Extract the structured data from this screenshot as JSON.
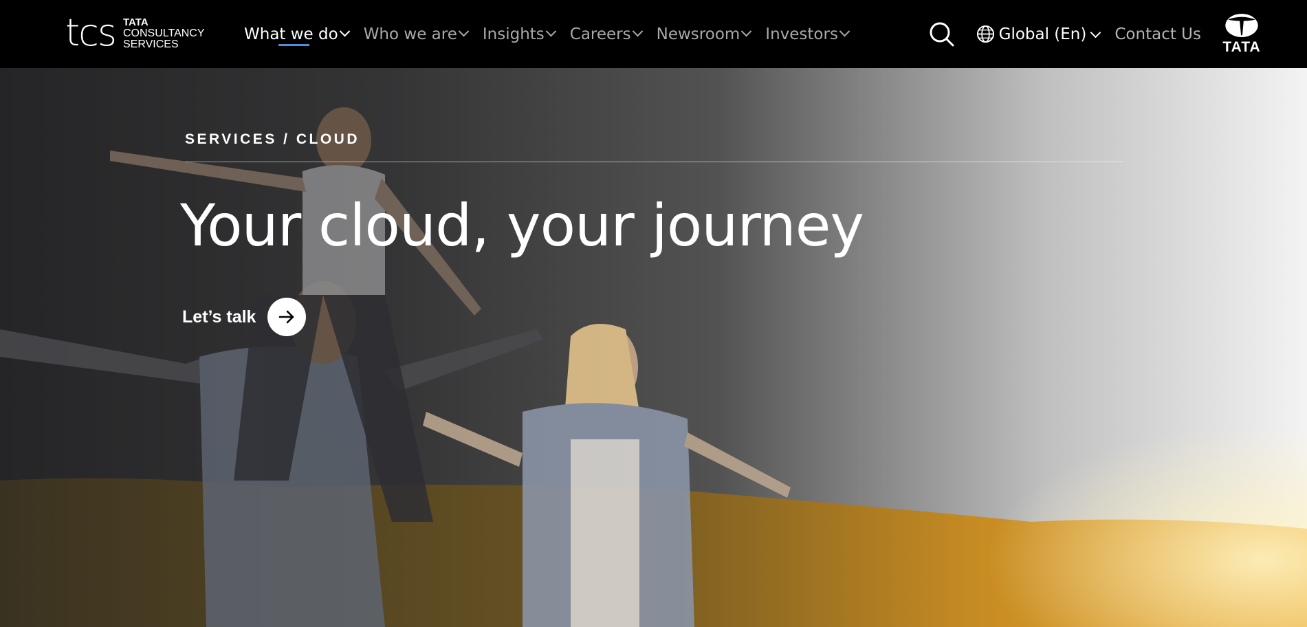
{
  "brand": {
    "logo_mark": "tcs",
    "logo_line1": "TATA",
    "logo_line2": "CONSULTANCY",
    "logo_line3": "SERVICES",
    "parent_logo_text": "TATA"
  },
  "nav": {
    "items": [
      {
        "label": "What we do",
        "active": true
      },
      {
        "label": "Who we are",
        "active": false
      },
      {
        "label": "Insights",
        "active": false
      },
      {
        "label": "Careers",
        "active": false
      },
      {
        "label": "Newsroom",
        "active": false
      },
      {
        "label": "Investors",
        "active": false
      }
    ],
    "search_icon": "search-icon",
    "language_label": "Global (En)",
    "contact_label": "Contact Us"
  },
  "hero": {
    "breadcrumb": "SERVICES / CLOUD",
    "headline": "Your cloud, your journey",
    "cta_label": "Let’s talk",
    "cta_icon": "arrow-right-icon"
  },
  "colors": {
    "nav_bg": "#000000",
    "active_underline": "#4a90e2",
    "text_primary": "#ffffff",
    "text_muted": "#a9a9a9"
  }
}
